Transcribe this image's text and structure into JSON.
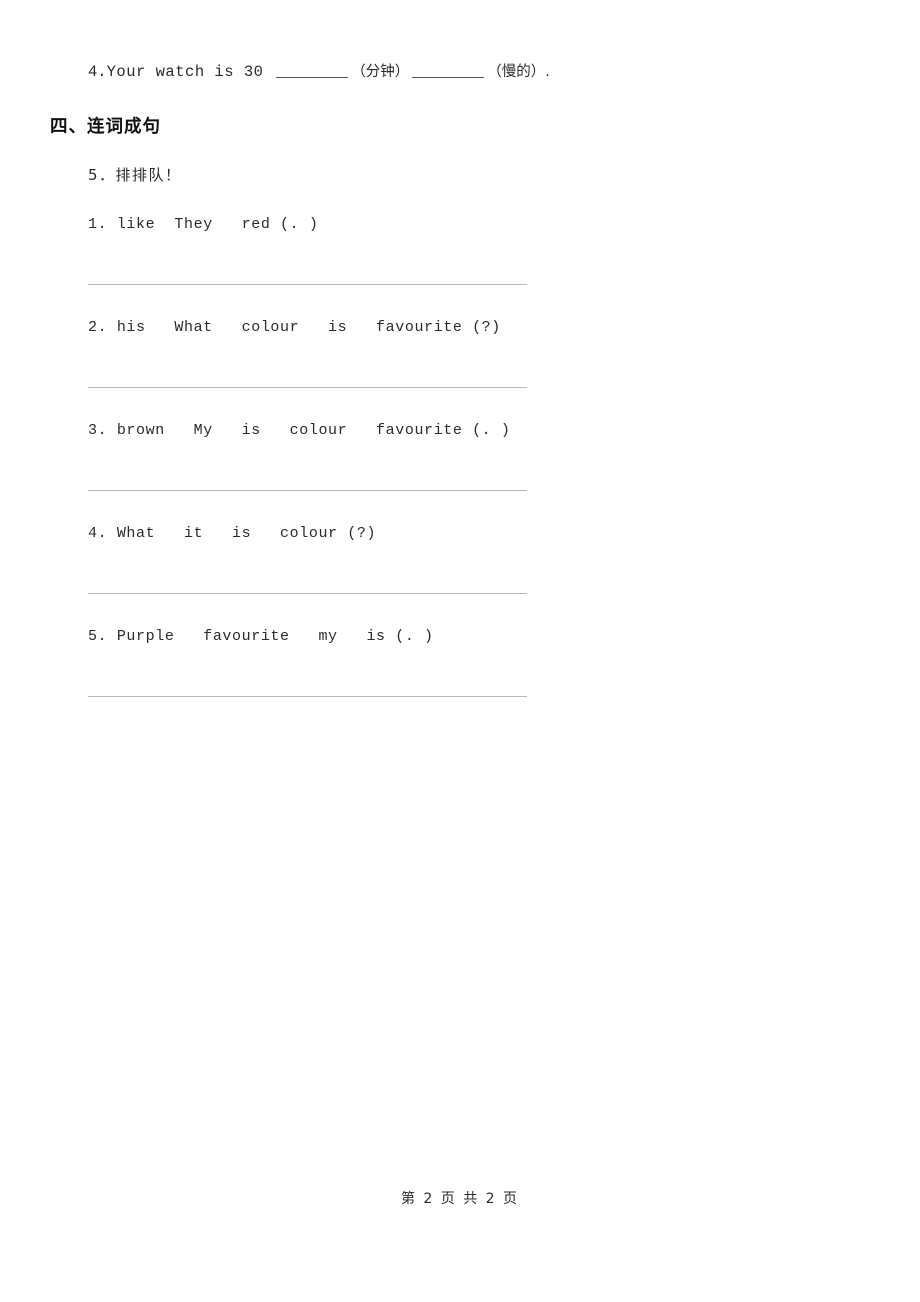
{
  "document": {
    "carryover_question": {
      "number": "4.",
      "text_before_blank1": "Your watch is 30",
      "blank1_hint": "（分钟）",
      "blank2_hint": "（慢的）",
      "trailing": "."
    },
    "section": {
      "heading": "四、连词成句",
      "prompt": "5．排排队！"
    },
    "questions": [
      {
        "number": "1.",
        "words": "like  They   red (. )"
      },
      {
        "number": "2.",
        "words": "his   What   colour   is   favourite (?)"
      },
      {
        "number": "3.",
        "words": "brown   My   is   colour   favourite (. )"
      },
      {
        "number": "4.",
        "words": "What   it   is   colour (?)"
      },
      {
        "number": "5.",
        "words": "Purple   favourite   my   is (. )"
      }
    ],
    "footer": {
      "text": "第 2 页 共 2 页"
    },
    "colors": {
      "text": "#2b2b2b",
      "rule": "#b9b4c4",
      "background": "#ffffff"
    }
  }
}
